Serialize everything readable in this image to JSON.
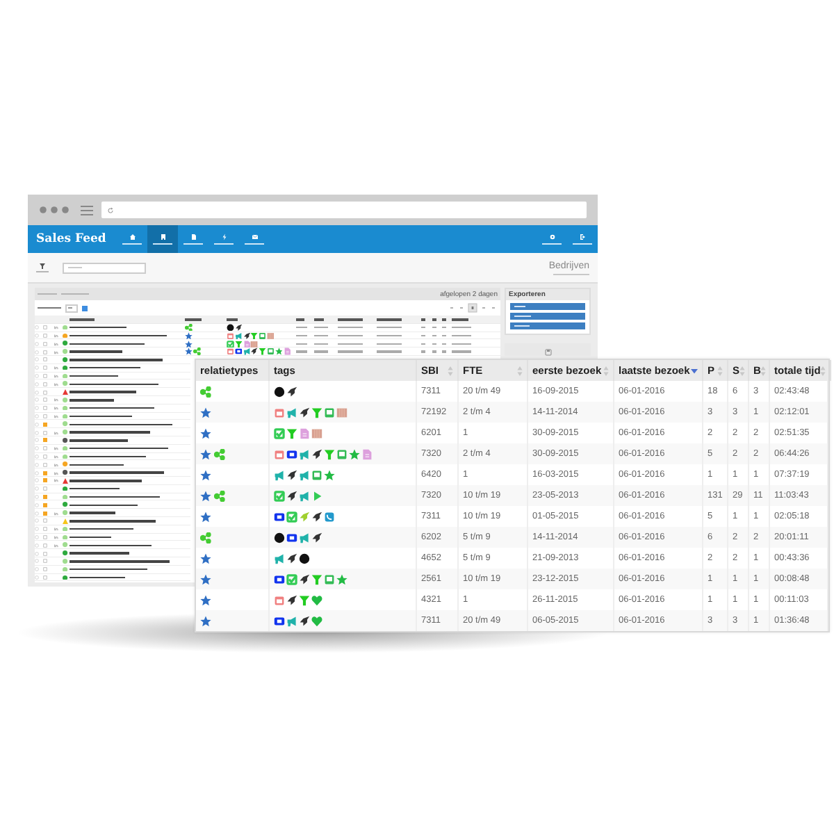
{
  "nav": {
    "logo": "Sales Feed",
    "items": [
      {
        "kind": "home",
        "selected": false
      },
      {
        "kind": "building",
        "selected": true
      },
      {
        "kind": "document",
        "selected": false
      },
      {
        "kind": "bolt",
        "selected": false
      },
      {
        "kind": "mail",
        "selected": false
      }
    ],
    "right_items": [
      {
        "kind": "gear"
      },
      {
        "kind": "logout"
      }
    ]
  },
  "toolbar": {
    "page_title": "Bedrijven"
  },
  "companies_panel": {
    "period": "afgelopen 2 dagen",
    "rows": [
      {
        "checked": false,
        "kind": "dot",
        "color": "#9fdc8f",
        "flag": false,
        "linkedin": true,
        "relations": [
          {
            "kind": "network"
          }
        ],
        "tags": [
          {
            "kind": "dot",
            "color": "#111111"
          },
          {
            "kind": "rocket",
            "color": "#333333"
          }
        ]
      },
      {
        "checked": false,
        "kind": "dot",
        "color": "#f5a623",
        "flag": false,
        "linkedin": true,
        "relations": [
          {
            "kind": "star"
          }
        ],
        "tags": [
          {
            "kind": "calendar",
            "color": "#f08080"
          },
          {
            "kind": "megaphone",
            "color": "#20b2aa"
          },
          {
            "kind": "rocket",
            "color": "#333333"
          },
          {
            "kind": "funnel",
            "color": "#22cc22"
          },
          {
            "kind": "screen",
            "color": "#33bb55"
          },
          {
            "kind": "strip",
            "color": "#d8a090"
          }
        ]
      },
      {
        "checked": false,
        "kind": "dot",
        "color": "#2eaa3e",
        "flag": false,
        "linkedin": true,
        "relations": [
          {
            "kind": "star"
          }
        ],
        "tags": [
          {
            "kind": "check",
            "color": "#33cc55"
          },
          {
            "kind": "funnel",
            "color": "#22cc22"
          },
          {
            "kind": "document",
            "color": "#dda0dd"
          },
          {
            "kind": "strip",
            "color": "#d8a090"
          }
        ]
      },
      {
        "checked": false,
        "kind": "dot",
        "color": "#9fdc8f",
        "flag": false,
        "linkedin": true,
        "relations": [
          {
            "kind": "star"
          },
          {
            "kind": "network"
          }
        ],
        "tags": [
          {
            "kind": "calendar",
            "color": "#f08080"
          },
          {
            "kind": "video",
            "color": "#1133ee"
          },
          {
            "kind": "megaphone",
            "color": "#20b2aa"
          },
          {
            "kind": "rocket",
            "color": "#333333"
          },
          {
            "kind": "funnel",
            "color": "#22cc22"
          },
          {
            "kind": "screen",
            "color": "#33bb55"
          },
          {
            "kind": "star",
            "color": "#22bb44"
          },
          {
            "kind": "document",
            "color": "#dda0dd"
          }
        ]
      },
      {
        "checked": false,
        "kind": "dot",
        "color": "#2eaa3e",
        "flag": false,
        "linkedin": false
      },
      {
        "checked": false,
        "kind": "dot",
        "color": "#2eaa3e",
        "flag": false,
        "linkedin": true
      },
      {
        "checked": false,
        "kind": "dot",
        "color": "#9fdc8f",
        "flag": false,
        "linkedin": true
      },
      {
        "checked": false,
        "kind": "dot",
        "color": "#9fdc8f",
        "flag": false,
        "linkedin": true
      },
      {
        "checked": false,
        "kind": "triangle",
        "color": "#e53935",
        "flag": false,
        "linkedin": false
      },
      {
        "checked": false,
        "kind": "dot",
        "color": "#9fdc8f",
        "flag": false,
        "linkedin": true
      },
      {
        "checked": false,
        "kind": "dot",
        "color": "#9fdc8f",
        "flag": false,
        "linkedin": true
      },
      {
        "checked": false,
        "kind": "dot",
        "color": "#9fdc8f",
        "flag": false,
        "linkedin": true
      },
      {
        "checked": false,
        "kind": "dot",
        "color": "#9fdc8f",
        "flag": true,
        "linkedin": false
      },
      {
        "checked": false,
        "kind": "dot",
        "color": "#9fdc8f",
        "flag": false,
        "linkedin": true
      },
      {
        "checked": false,
        "kind": "dot",
        "color": "#555555",
        "flag": true,
        "linkedin": false
      },
      {
        "checked": false,
        "kind": "dot",
        "color": "#9fdc8f",
        "flag": false,
        "linkedin": true
      },
      {
        "checked": false,
        "kind": "dot",
        "color": "#9fdc8f",
        "flag": false,
        "linkedin": true
      },
      {
        "checked": false,
        "kind": "dot",
        "color": "#f5a623",
        "flag": false,
        "linkedin": true
      },
      {
        "checked": false,
        "kind": "dot",
        "color": "#555555",
        "flag": true,
        "linkedin": true
      },
      {
        "checked": false,
        "kind": "triangle",
        "color": "#e53935",
        "flag": true,
        "linkedin": true
      },
      {
        "checked": false,
        "kind": "dot",
        "color": "#2eaa3e",
        "flag": false,
        "linkedin": false
      },
      {
        "checked": false,
        "kind": "dot",
        "color": "#9fdc8f",
        "flag": true,
        "linkedin": false
      },
      {
        "checked": false,
        "kind": "dot",
        "color": "#2eaa3e",
        "flag": true,
        "linkedin": false
      },
      {
        "checked": false,
        "kind": "dot",
        "color": "#9fdc8f",
        "flag": true,
        "linkedin": true
      },
      {
        "checked": false,
        "kind": "triangle",
        "color": "#f5c518",
        "flag": false,
        "linkedin": false
      },
      {
        "checked": false,
        "kind": "dot",
        "color": "#9fdc8f",
        "flag": false,
        "linkedin": true
      },
      {
        "checked": false,
        "kind": "dot",
        "color": "#9fdc8f",
        "flag": false,
        "linkedin": true
      },
      {
        "checked": false,
        "kind": "dot",
        "color": "#9fdc8f",
        "flag": false,
        "linkedin": true
      },
      {
        "checked": false,
        "kind": "dot",
        "color": "#2eaa3e",
        "flag": false,
        "linkedin": false
      },
      {
        "checked": false,
        "kind": "dot",
        "color": "#9fdc8f",
        "flag": false,
        "linkedin": false
      },
      {
        "checked": false,
        "kind": "dot",
        "color": "#9fdc8f",
        "flag": false,
        "linkedin": false
      },
      {
        "checked": false,
        "kind": "dot",
        "color": "#2eaa3e",
        "flag": false,
        "linkedin": false
      }
    ]
  },
  "export_panel": {
    "title": "Exporteren"
  },
  "detail_table": {
    "columns": [
      {
        "label": "relatietypes",
        "sortable": false
      },
      {
        "label": "tags",
        "sortable": false
      },
      {
        "label": "SBI",
        "sortable": true,
        "sorted": false
      },
      {
        "label": "FTE",
        "sortable": true,
        "sorted": false
      },
      {
        "label": "eerste bezoek",
        "sortable": true,
        "sorted": false
      },
      {
        "label": "laatste bezoek",
        "sortable": true,
        "sorted": true
      },
      {
        "label": "P",
        "sortable": true,
        "sorted": false
      },
      {
        "label": "S",
        "sortable": true,
        "sorted": false
      },
      {
        "label": "B",
        "sortable": true,
        "sorted": false
      },
      {
        "label": "totale tijd",
        "sortable": true,
        "sorted": false
      }
    ],
    "rows": [
      {
        "relations": [
          {
            "kind": "network"
          }
        ],
        "tags": [
          {
            "kind": "dot",
            "color": "#111111"
          },
          {
            "kind": "rocket",
            "color": "#333333"
          }
        ],
        "values": [
          "7311",
          "20 t/m 49",
          "16-09-2015",
          "06-01-2016",
          "18",
          "6",
          "3",
          "02:43:48"
        ]
      },
      {
        "relations": [
          {
            "kind": "star"
          }
        ],
        "tags": [
          {
            "kind": "calendar",
            "color": "#f08080"
          },
          {
            "kind": "megaphone",
            "color": "#20b2aa"
          },
          {
            "kind": "rocket",
            "color": "#333333"
          },
          {
            "kind": "funnel",
            "color": "#22cc22"
          },
          {
            "kind": "screen",
            "color": "#33bb55"
          },
          {
            "kind": "strip",
            "color": "#d8a090"
          }
        ],
        "values": [
          "72192",
          "2 t/m 4",
          "14-11-2014",
          "06-01-2016",
          "3",
          "3",
          "1",
          "02:12:01"
        ]
      },
      {
        "relations": [
          {
            "kind": "star"
          }
        ],
        "tags": [
          {
            "kind": "check",
            "color": "#33cc55"
          },
          {
            "kind": "funnel",
            "color": "#22cc22"
          },
          {
            "kind": "document",
            "color": "#dda0dd"
          },
          {
            "kind": "strip",
            "color": "#d8a090"
          }
        ],
        "values": [
          "6201",
          "1",
          "30-09-2015",
          "06-01-2016",
          "2",
          "2",
          "2",
          "02:51:35"
        ]
      },
      {
        "relations": [
          {
            "kind": "star"
          },
          {
            "kind": "network"
          }
        ],
        "tags": [
          {
            "kind": "calendar",
            "color": "#f08080"
          },
          {
            "kind": "video",
            "color": "#1133ee"
          },
          {
            "kind": "megaphone",
            "color": "#20b2aa"
          },
          {
            "kind": "rocket",
            "color": "#333333"
          },
          {
            "kind": "funnel",
            "color": "#22cc22"
          },
          {
            "kind": "screen",
            "color": "#33bb55"
          },
          {
            "kind": "star",
            "color": "#22bb44"
          },
          {
            "kind": "document",
            "color": "#dda0dd"
          }
        ],
        "values": [
          "7320",
          "2 t/m 4",
          "30-09-2015",
          "06-01-2016",
          "5",
          "2",
          "2",
          "06:44:26"
        ]
      },
      {
        "relations": [
          {
            "kind": "star"
          }
        ],
        "tags": [
          {
            "kind": "megaphone",
            "color": "#20b2aa"
          },
          {
            "kind": "rocket",
            "color": "#333333"
          },
          {
            "kind": "megaphone",
            "color": "#20b2aa"
          },
          {
            "kind": "screen",
            "color": "#33bb55"
          },
          {
            "kind": "star",
            "color": "#22bb44"
          }
        ],
        "values": [
          "6420",
          "1",
          "16-03-2015",
          "06-01-2016",
          "1",
          "1",
          "1",
          "07:37:19"
        ]
      },
      {
        "relations": [
          {
            "kind": "star"
          },
          {
            "kind": "network"
          }
        ],
        "tags": [
          {
            "kind": "check",
            "color": "#33cc55"
          },
          {
            "kind": "rocket",
            "color": "#333333"
          },
          {
            "kind": "megaphone",
            "color": "#20b2aa"
          },
          {
            "kind": "play",
            "color": "#33cc55"
          }
        ],
        "values": [
          "7320",
          "10 t/m 19",
          "23-05-2013",
          "06-01-2016",
          "131",
          "29",
          "11",
          "11:03:43"
        ]
      },
      {
        "relations": [
          {
            "kind": "star"
          }
        ],
        "tags": [
          {
            "kind": "video",
            "color": "#1133ee"
          },
          {
            "kind": "check",
            "color": "#33cc55"
          },
          {
            "kind": "rocket",
            "color": "#a0d030"
          },
          {
            "kind": "rocket",
            "color": "#333333"
          },
          {
            "kind": "phone",
            "color": "#2299cc"
          }
        ],
        "values": [
          "7311",
          "10 t/m 19",
          "01-05-2015",
          "06-01-2016",
          "5",
          "1",
          "1",
          "02:05:18"
        ]
      },
      {
        "relations": [
          {
            "kind": "network"
          }
        ],
        "tags": [
          {
            "kind": "dot",
            "color": "#111111"
          },
          {
            "kind": "video",
            "color": "#1133ee"
          },
          {
            "kind": "megaphone",
            "color": "#20b2aa"
          },
          {
            "kind": "rocket",
            "color": "#333333"
          }
        ],
        "values": [
          "6202",
          "5 t/m 9",
          "14-11-2014",
          "06-01-2016",
          "6",
          "2",
          "2",
          "20:01:11"
        ]
      },
      {
        "relations": [
          {
            "kind": "star"
          }
        ],
        "tags": [
          {
            "kind": "megaphone",
            "color": "#20b2aa"
          },
          {
            "kind": "rocket",
            "color": "#333333"
          },
          {
            "kind": "dot",
            "color": "#111111"
          }
        ],
        "values": [
          "4652",
          "5 t/m 9",
          "21-09-2013",
          "06-01-2016",
          "2",
          "2",
          "1",
          "00:43:36"
        ]
      },
      {
        "relations": [
          {
            "kind": "star"
          }
        ],
        "tags": [
          {
            "kind": "video",
            "color": "#1133ee"
          },
          {
            "kind": "check",
            "color": "#33cc55"
          },
          {
            "kind": "rocket",
            "color": "#333333"
          },
          {
            "kind": "funnel",
            "color": "#22cc22"
          },
          {
            "kind": "screen",
            "color": "#33bb55"
          },
          {
            "kind": "star",
            "color": "#22bb44"
          }
        ],
        "values": [
          "2561",
          "10 t/m 19",
          "23-12-2015",
          "06-01-2016",
          "1",
          "1",
          "1",
          "00:08:48"
        ]
      },
      {
        "relations": [
          {
            "kind": "star"
          }
        ],
        "tags": [
          {
            "kind": "calendar",
            "color": "#f08080"
          },
          {
            "kind": "rocket",
            "color": "#333333"
          },
          {
            "kind": "funnel",
            "color": "#22cc22"
          },
          {
            "kind": "heart",
            "color": "#22bb44"
          }
        ],
        "values": [
          "4321",
          "1",
          "26-11-2015",
          "06-01-2016",
          "1",
          "1",
          "1",
          "00:11:03"
        ]
      },
      {
        "relations": [
          {
            "kind": "star"
          }
        ],
        "tags": [
          {
            "kind": "video",
            "color": "#1133ee"
          },
          {
            "kind": "megaphone",
            "color": "#20b2aa"
          },
          {
            "kind": "rocket",
            "color": "#333333"
          },
          {
            "kind": "heart",
            "color": "#22bb44"
          }
        ],
        "values": [
          "7311",
          "20 t/m 49",
          "06-05-2015",
          "06-01-2016",
          "3",
          "3",
          "1",
          "01:36:48"
        ]
      }
    ]
  }
}
